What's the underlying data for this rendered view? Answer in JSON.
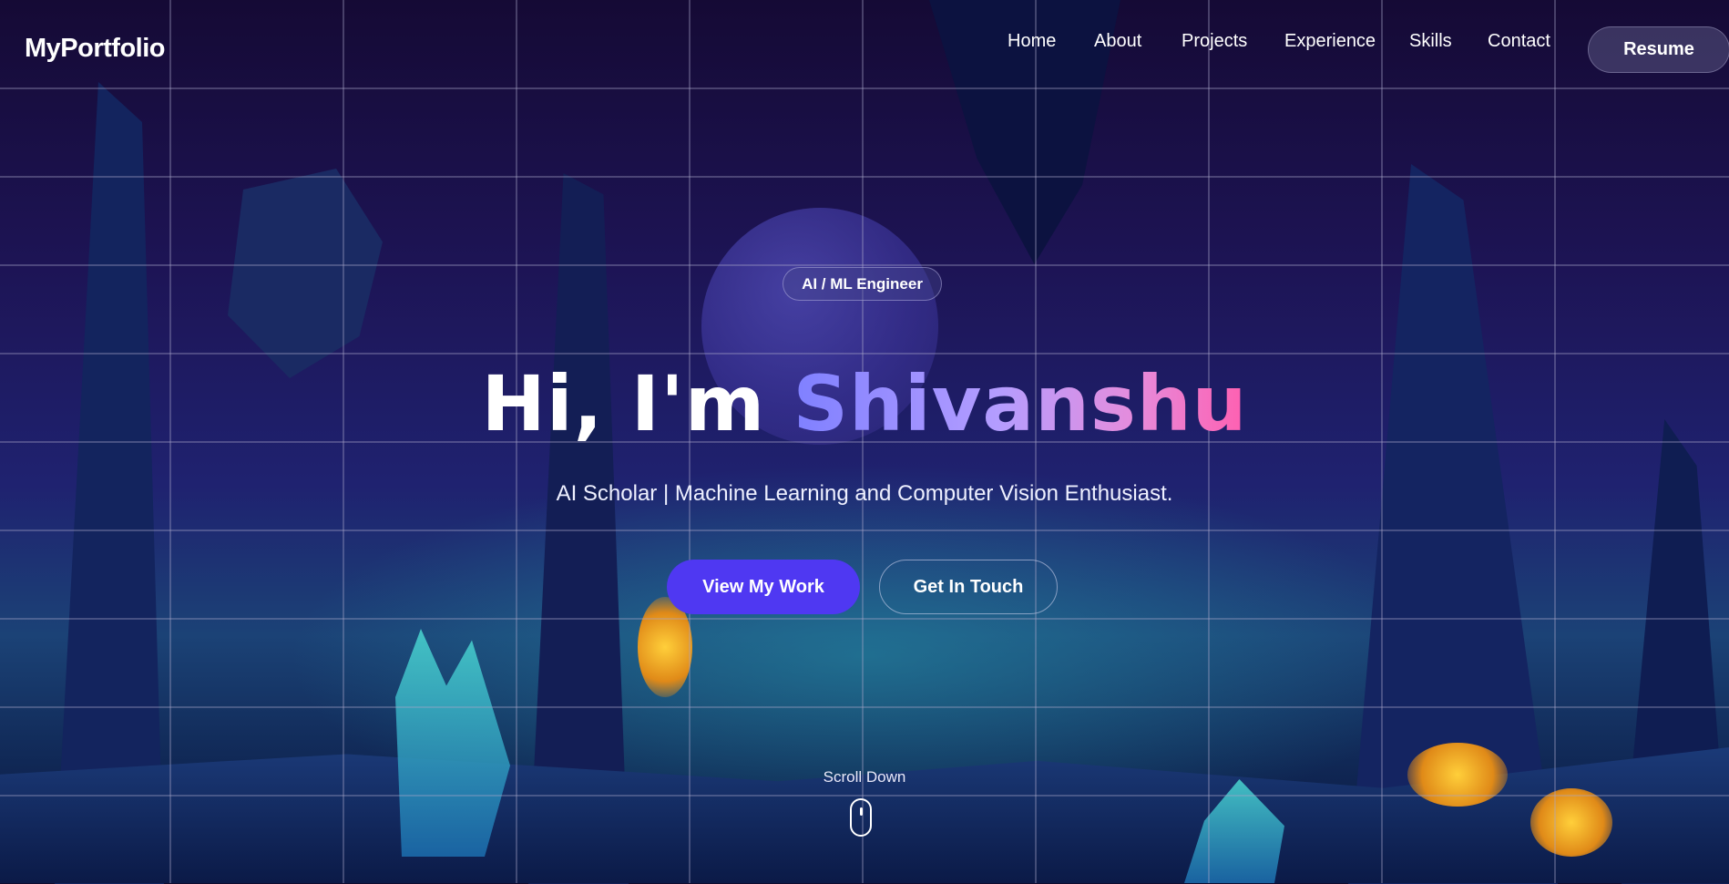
{
  "nav": {
    "logo": "MyPortfolio",
    "items": [
      {
        "label": "Home"
      },
      {
        "label": "About"
      },
      {
        "label": "Projects"
      },
      {
        "label": "Experience"
      },
      {
        "label": "Skills"
      },
      {
        "label": "Contact"
      }
    ],
    "resume_label": "Resume"
  },
  "hero": {
    "badge": "AI / ML Engineer",
    "greeting": "Hi, I'm ",
    "name": "Shivanshu",
    "subtitle": "AI Scholar | Machine Learning and Computer Vision Enthusiast.",
    "primary_cta": "View My Work",
    "secondary_cta": "Get In Touch",
    "scroll_label": "Scroll Down"
  },
  "icons": {
    "scroll": "mouse-scroll-icon"
  },
  "colors": {
    "accent": "#4f38f2",
    "gradient_start": "#7f80ff",
    "gradient_end": "#ff5fb0"
  }
}
